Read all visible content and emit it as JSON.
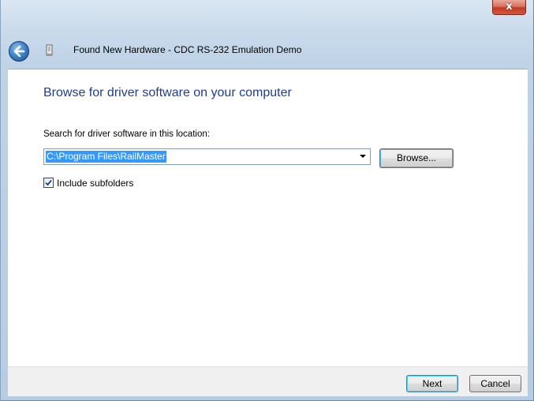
{
  "window": {
    "title": "Found New Hardware - CDC RS-232 Emulation Demo",
    "close_glyph": "x"
  },
  "main": {
    "heading": "Browse for driver software on your computer",
    "search_label": "Search for driver software in this location:",
    "path_value": "C:\\Program Files\\RailMaster",
    "browse_label": "Browse...",
    "include_subfolders_label": "Include subfolders",
    "include_subfolders_checked": true
  },
  "footer": {
    "next_label": "Next",
    "cancel_label": "Cancel"
  },
  "icons": {
    "back": "back-arrow-icon",
    "hardware": "hardware-device-icon",
    "close": "close-icon",
    "dropdown": "chevron-down-icon",
    "check": "checkmark-icon"
  },
  "colors": {
    "heading": "#1e3d8f",
    "selection": "#3399ff",
    "close_button": "#c43a22"
  }
}
